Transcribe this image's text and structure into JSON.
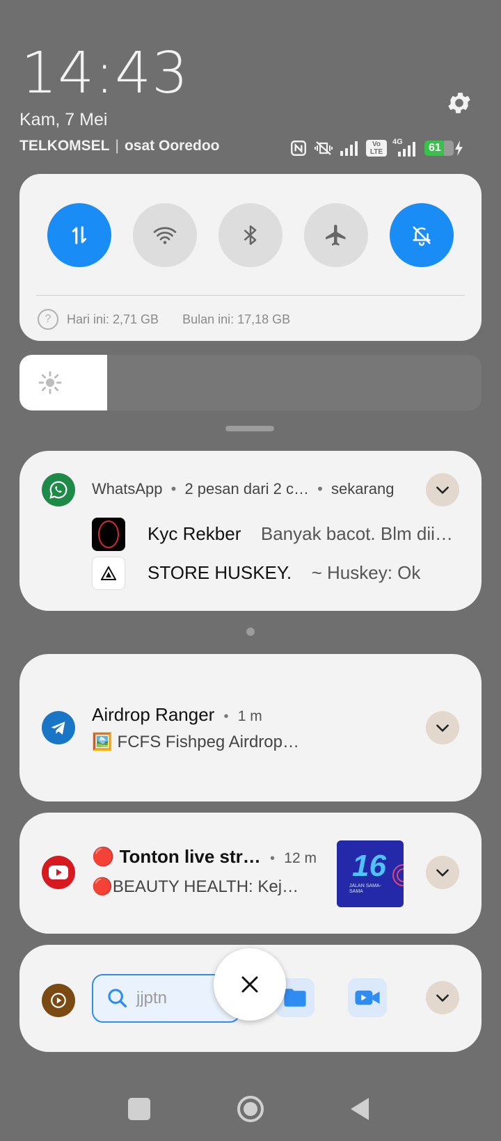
{
  "clock": {
    "time": "14:43",
    "date": "Kam, 7 Mei"
  },
  "carriers": {
    "primary": "TELKOMSEL",
    "separator": "|",
    "secondary": "osat Ooredoo"
  },
  "status_bar": {
    "battery": "61",
    "volte": "Vo LTE",
    "net": "4G"
  },
  "quick_settings": {
    "tiles": [
      {
        "name": "mobile-data",
        "icon": "arrows-updown-icon",
        "active": true
      },
      {
        "name": "wifi",
        "icon": "wifi-icon",
        "active": false
      },
      {
        "name": "bluetooth",
        "icon": "bluetooth-icon",
        "active": false
      },
      {
        "name": "airplane",
        "icon": "airplane-icon",
        "active": false
      },
      {
        "name": "silent",
        "icon": "bell-off-icon",
        "active": true
      }
    ],
    "usage_today": "Hari ini: 2,71 GB",
    "usage_month": "Bulan ini: 17,18 GB"
  },
  "brightness": {
    "level": 0.19
  },
  "notifications": {
    "whatsapp": {
      "app": "WhatsApp",
      "summary": "2 pesan dari 2 c…",
      "time": "sekarang",
      "messages": [
        {
          "sender": "Kyc Rekber",
          "text": "Banyak bacot. Blm dii…"
        },
        {
          "sender": "STORE HUSKEY.",
          "text": "~ Huskey: Ok"
        }
      ]
    },
    "telegram": {
      "title": "Airdrop Ranger",
      "time": "1 m",
      "text": "🖼️ FCFS Fishpeg Airdrop…"
    },
    "youtube": {
      "title": "🔴 Tonton live str…",
      "time": "12 m",
      "text": "🔴BEAUTY HEALTH: Kej…",
      "thumb_text": "JALAN SAMA-SAMA"
    },
    "player": {
      "search_value": "jjptn"
    }
  },
  "colors": {
    "accent": "#1a8cf5",
    "card": "#f3f3f3",
    "background": "#6f6f6f"
  }
}
